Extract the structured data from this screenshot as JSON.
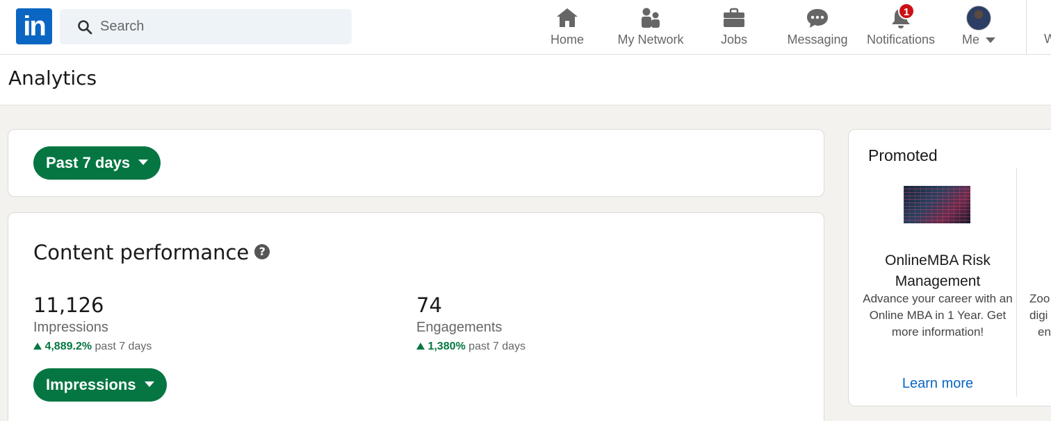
{
  "nav": {
    "logo_text": "in",
    "search_placeholder": "Search",
    "items": [
      {
        "label": "Home",
        "icon": "home-icon"
      },
      {
        "label": "My Network",
        "icon": "people-icon"
      },
      {
        "label": "Jobs",
        "icon": "briefcase-icon"
      },
      {
        "label": "Messaging",
        "icon": "chat-icon"
      },
      {
        "label": "Notifications",
        "icon": "bell-icon",
        "badge": "1"
      },
      {
        "label": "Me",
        "icon": "avatar"
      }
    ],
    "cut_label": "W"
  },
  "page": {
    "title": "Analytics"
  },
  "filter": {
    "range_label": "Past 7 days"
  },
  "content_performance": {
    "title": "Content performance",
    "help_glyph": "?",
    "metrics": [
      {
        "value": "11,126",
        "label": "Impressions",
        "change": "4,889.2%",
        "period": "past 7 days"
      },
      {
        "value": "74",
        "label": "Engagements",
        "change": "1,380%",
        "period": "past 7 days"
      }
    ],
    "metric_selector_label": "Impressions"
  },
  "promoted": {
    "title": "Promoted",
    "ad": {
      "name": "OnlineMBA Risk Management",
      "description": "Advance your career with an Online MBA in 1 Year. Get more information!",
      "cta": "Learn more"
    },
    "cut_text": [
      "Zoo",
      "digi",
      "en"
    ]
  },
  "colors": {
    "brand": "#0a66c2",
    "accent_green": "#057642",
    "badge_red": "#cc1016"
  }
}
